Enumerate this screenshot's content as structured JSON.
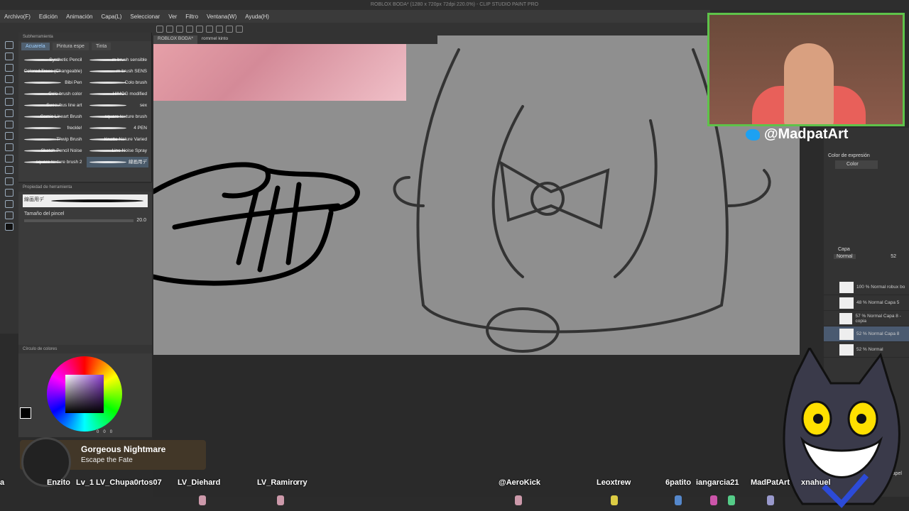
{
  "window": {
    "title": "ROBLOX BODA* (1280 x 720px 72dpi 220.0%) - CLIP STUDIO PAINT PRO"
  },
  "menu": [
    "Archivo(F)",
    "Edición",
    "Animación",
    "Capa(L)",
    "Seleccionar",
    "Ver",
    "Filtro",
    "Ventana(W)",
    "Ayuda(H)"
  ],
  "doc_tabs": [
    "ROBLOX BODA*",
    "rommel kinto"
  ],
  "subtool": {
    "header": "Subherramienta",
    "tabs": [
      "Acuarela",
      "Pintura espe",
      "Tinta"
    ],
    "brushes": [
      {
        "left": "Synthetic Pencil",
        "right": "m brush sensible"
      },
      {
        "left": "Colored Trees (Changeable)",
        "right": "m brush SENS"
      },
      {
        "left": "Bibi Pen",
        "right": "Colo brush"
      },
      {
        "left": "Colo brush color",
        "right": "HIMOG modified"
      },
      {
        "left": "Suecubus line art",
        "right": "sex"
      },
      {
        "left": "Comic Lineart Brush",
        "right": "square texture brush"
      },
      {
        "left": "freckle!",
        "right": "4 PEN"
      },
      {
        "left": "Thwip Brush",
        "right": "Knotte Nature Varied"
      },
      {
        "left": "Sketch Pencil Noise",
        "right": "Line Noise Spray"
      },
      {
        "left": "square texture brush 2",
        "right": "線画用デ"
      }
    ]
  },
  "tool_property": {
    "header": "Propiedad de herramienta",
    "brush_name": "線画用デ",
    "size_label": "Tamaño del pincel",
    "size_value": "20.0"
  },
  "color_panel": {
    "header": "Círculo de colores",
    "r": "0",
    "g": "0",
    "b": "0"
  },
  "right_panel": {
    "expression_label": "Color de expresión",
    "expression_value": "Color",
    "layer_header": "Capa",
    "blend_mode": "Normal",
    "opacity": "52",
    "layers": [
      {
        "pct": "100 %",
        "mode": "Normal",
        "name": "robux bo"
      },
      {
        "pct": "48 %",
        "mode": "Normal",
        "name": "Capa 5"
      },
      {
        "pct": "57 %",
        "mode": "Normal",
        "name": "Capa 8 - copia"
      },
      {
        "pct": "52 %",
        "mode": "Normal",
        "name": "Capa 8"
      },
      {
        "pct": "52 %",
        "mode": "Normal",
        "name": ""
      }
    ],
    "paper_label": "Papel"
  },
  "stream": {
    "handle": "@MadpatArt",
    "song_title": "Gorgeous Nightmare",
    "song_artist": "Escape the Fate",
    "viewers": [
      "a",
      "Enzito",
      "Lv_1",
      "LV_Chupa0rtos07",
      "LV_Diehard",
      "LV_Ramiro",
      "rry",
      "@AeroKick",
      "Leoxtrew",
      "6patito",
      "iangarcia21",
      "MadPatArt",
      "xnahuel"
    ]
  },
  "colors": {
    "accent": "#5ec34a",
    "twitter": "#1da1f2",
    "canvas": "#8f8f8f"
  }
}
